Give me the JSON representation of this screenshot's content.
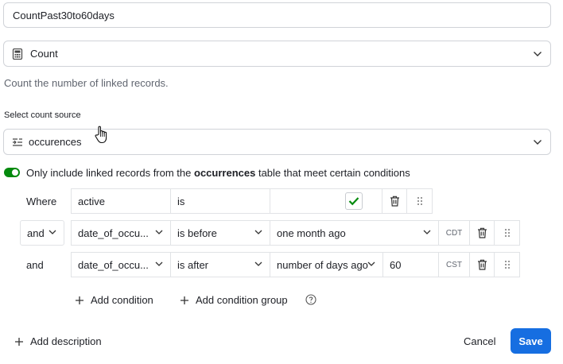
{
  "name_field": {
    "value": "CountPast30to60days"
  },
  "type_select": {
    "value": "Count",
    "icon": "calculator-icon"
  },
  "type_description": "Count the number of linked records.",
  "count_source": {
    "label": "Select count source",
    "value": "occurences"
  },
  "filter_toggle": {
    "on": true,
    "text_before": "Only include linked records from the",
    "table_name": "occurrences",
    "text_after": "table that meet certain conditions"
  },
  "conditions": [
    {
      "conjunction": "Where",
      "field": "active",
      "operator": "is",
      "value": "",
      "checked": true
    },
    {
      "conjunction": "and",
      "field": "date_of_occu...",
      "operator": "is before",
      "value": "one month ago",
      "timezone": "CDT"
    },
    {
      "conjunction": "and",
      "field": "date_of_occu...",
      "operator": "is after",
      "value": "number of days ago",
      "number": "60",
      "timezone": "CST"
    }
  ],
  "actions": {
    "add_condition": "Add condition",
    "add_condition_group": "Add condition group",
    "add_description": "Add description",
    "cancel": "Cancel",
    "save": "Save"
  },
  "colors": {
    "accent": "#166ee1",
    "toggle_on": "#048a0e",
    "check": "#048a0e"
  }
}
